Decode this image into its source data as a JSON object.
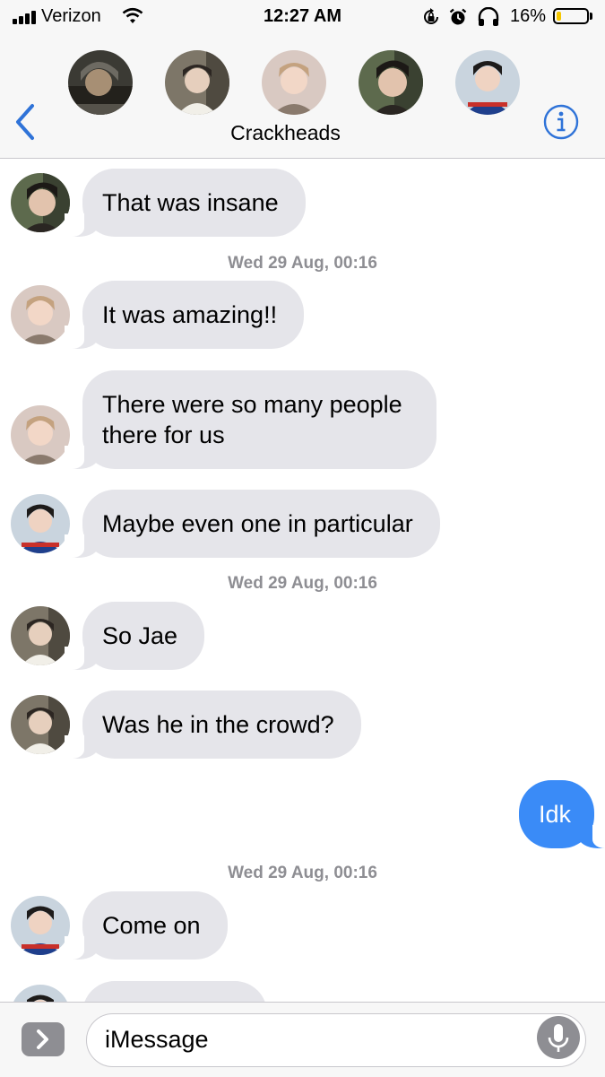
{
  "status_bar": {
    "carrier": "Verizon",
    "time": "12:27 AM",
    "battery_percent": "16%",
    "battery_level": 0.16,
    "battery_color": "#f5c700",
    "icons": [
      "signal-bars-icon",
      "wifi-icon",
      "screen-lock-rotation-icon",
      "alarm-icon",
      "headphones-icon",
      "battery-icon"
    ]
  },
  "header": {
    "group_name": "Crackheads",
    "back_icon": "chevron-left-icon",
    "info_icon": "info-icon",
    "accent_color": "#2f73d8",
    "participants": 5
  },
  "messages": [
    {
      "type": "received",
      "text": "That was insane"
    },
    {
      "type": "timestamp",
      "text": "Wed 29 Aug, 00:16"
    },
    {
      "type": "received",
      "text": "It was amazing!!"
    },
    {
      "type": "received",
      "lines": [
        "There were so many people",
        "there for us"
      ]
    },
    {
      "type": "received",
      "text": "Maybe even one in particular"
    },
    {
      "type": "timestamp",
      "text": "Wed 29 Aug, 00:16"
    },
    {
      "type": "received",
      "text": "So Jae"
    },
    {
      "type": "received",
      "text": "Was he in the crowd?"
    },
    {
      "type": "sent",
      "text": "Idk"
    },
    {
      "type": "timestamp",
      "text": "Wed 29 Aug, 00:16"
    },
    {
      "type": "received",
      "text": "Come on"
    }
  ],
  "colors": {
    "sent_bubble": "#3a8bf7",
    "received_bubble": "#e5e5ea",
    "timestamp": "#8e8e93"
  },
  "input": {
    "placeholder": "iMessage",
    "apps_icon": "app-store-chevron-icon",
    "mic_icon": "microphone-icon"
  }
}
